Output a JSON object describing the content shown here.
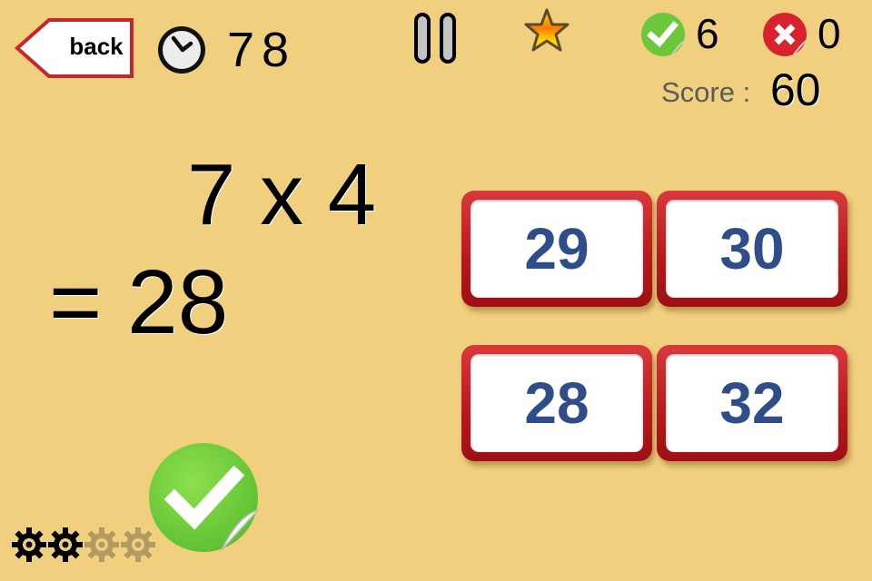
{
  "header": {
    "back_label": "back",
    "timer_value": "78",
    "correct_count": "6",
    "wrong_count": "0",
    "score_label": "Score :",
    "score_value": "60"
  },
  "icons": {
    "back": "back-arrow-icon",
    "timer": "clock-icon",
    "pause": "pause-icon",
    "star": "star-icon",
    "correct": "check-sticker-icon",
    "wrong": "x-sticker-icon",
    "feedback": "check-sticker-icon",
    "progress": "gear-icon"
  },
  "question": {
    "expression": "7 x 4",
    "answer_line": "= 28"
  },
  "answers": [
    "29",
    "30",
    "28",
    "32"
  ],
  "feedback": {
    "state": "correct"
  },
  "progress": {
    "filled": 2,
    "total": 4
  },
  "colors": {
    "background": "#f0cf7e",
    "button_border": "#b5181c",
    "answer_text": "#2f4e89",
    "correct_green": "#6cc83a",
    "wrong_red": "#d8232e"
  }
}
